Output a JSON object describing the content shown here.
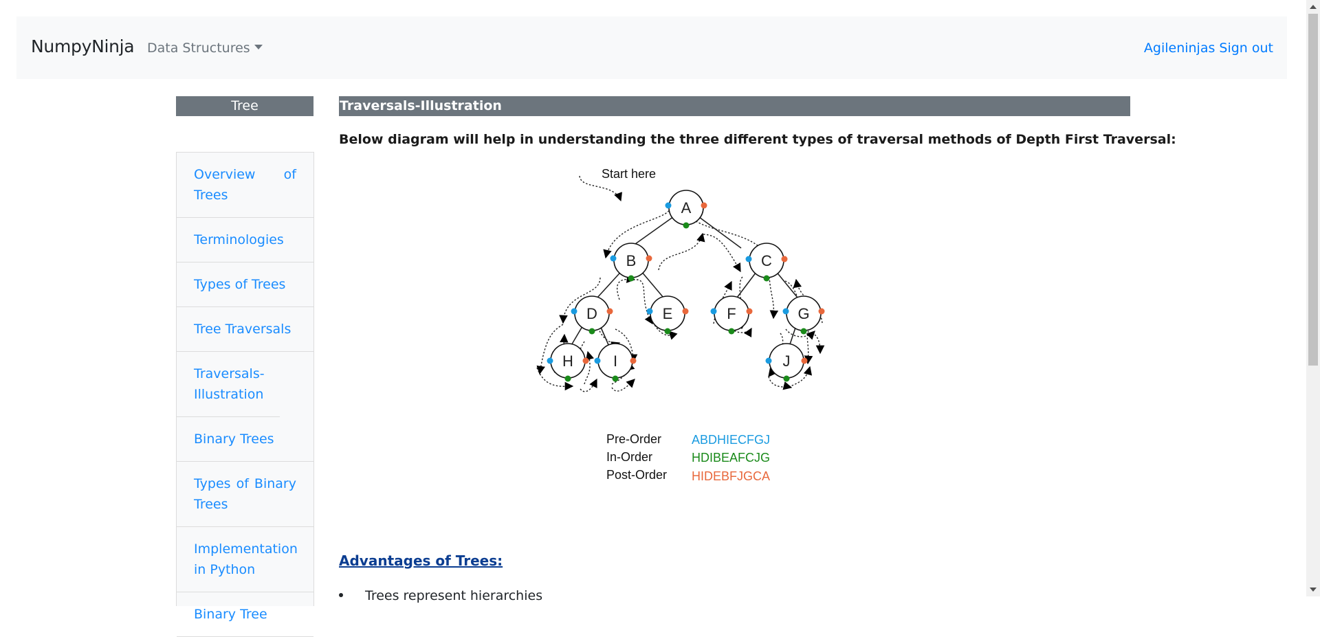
{
  "navbar": {
    "brand": "NumpyNinja",
    "dropdown_label": "Data Structures",
    "user": "Agileninjas",
    "signout": "Sign out"
  },
  "sidebar": {
    "header": "Tree",
    "items": [
      {
        "label": "Overview of Trees"
      },
      {
        "label": "Terminologies"
      },
      {
        "label": "Types of Trees"
      },
      {
        "label": "Tree Traversals"
      },
      {
        "label": "Traversals-Illustration"
      },
      {
        "label": "Binary Trees"
      },
      {
        "label": "Types of Binary Trees"
      },
      {
        "label": "Implementation in Python"
      },
      {
        "label": "Binary Tree"
      }
    ]
  },
  "main": {
    "title": "Traversals-Illustration",
    "intro": "Below diagram will help in understanding the three different types of traversal methods of Depth First Traversal:",
    "advantages_heading": "Advantages of Trees:",
    "bullet_1": "Trees represent hierarchies"
  },
  "diagram": {
    "start_label": "Start here",
    "nodes": [
      "A",
      "B",
      "C",
      "D",
      "E",
      "F",
      "G",
      "H",
      "I",
      "J"
    ],
    "legend": {
      "pre_label": "Pre-Order",
      "pre_value": "ABDHIECFGJ",
      "in_label": "In-Order",
      "in_value": "HDIBEAFCJG",
      "post_label": "Post-Order",
      "post_value": "HIDEBFJGCA"
    },
    "colors": {
      "pre": "#1a9be0",
      "in": "#1a8a1a",
      "post": "#e8683c"
    }
  }
}
